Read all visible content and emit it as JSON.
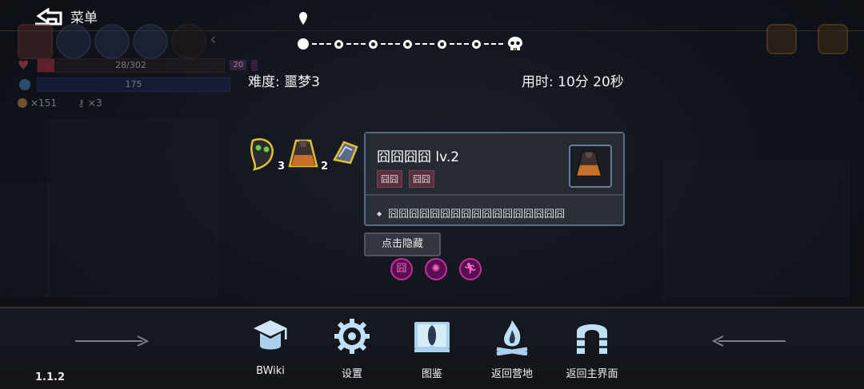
{
  "menu": {
    "label": "菜单"
  },
  "player": {
    "hp_text": "28/302",
    "hp_fraction": 0.093,
    "mana_text": "175",
    "level": "20",
    "coins": "×151",
    "keys": "×3"
  },
  "route": {
    "nodes": 6,
    "current_index": 0,
    "end_icon": "skull-icon",
    "marker_icon": "map-pin-icon"
  },
  "difficulty": "难度: 噩梦3",
  "time": "用时: 10分 20秒",
  "items": [
    {
      "name": "plague-mask-icon",
      "count": "3"
    },
    {
      "name": "cloak-icon",
      "count": "2"
    },
    {
      "name": "crystal-icon",
      "count": ""
    }
  ],
  "tooltip": {
    "title": "囧囧囧囧 lv.2",
    "tags": [
      "囧囧",
      "囧囧"
    ],
    "description": "囧囧囧囧囧囧囧囧囧囧囧囧囧囧囧囧囧",
    "icon": "cloak-icon"
  },
  "hide_button": "点击隐藏",
  "effect_chips": [
    "囧",
    "sun-rune-icon",
    "running-figure-icon"
  ],
  "bottom_nav": [
    {
      "label": "BWiki",
      "icon": "graduation-cap-icon"
    },
    {
      "label": "设置",
      "icon": "gear-icon"
    },
    {
      "label": "图鉴",
      "icon": "book-icon"
    },
    {
      "label": "返回营地",
      "icon": "campfire-icon"
    },
    {
      "label": "返回主界面",
      "icon": "archway-icon"
    }
  ],
  "version": "1.1.2",
  "colors": {
    "hp": "#b03040",
    "mana": "#1d2250",
    "chip": "#c0309a",
    "tooltip_border": "#5a6a80"
  }
}
